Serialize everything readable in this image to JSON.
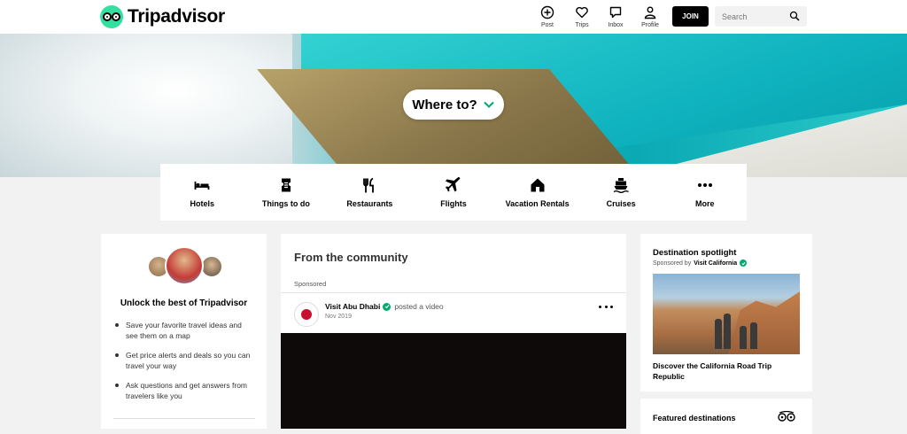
{
  "header": {
    "logo": "Tripadvisor",
    "nav": [
      {
        "label": "Post",
        "icon": "plus-circle-icon"
      },
      {
        "label": "Trips",
        "icon": "heart-icon"
      },
      {
        "label": "Inbox",
        "icon": "chat-icon"
      },
      {
        "label": "Profile",
        "icon": "person-icon"
      }
    ],
    "join_label": "JOIN",
    "search_placeholder": "Search"
  },
  "hero": {
    "where_to": "Where to?"
  },
  "categories": [
    {
      "label": "Hotels",
      "icon": "bed-icon"
    },
    {
      "label": "Things to do",
      "icon": "ticket-icon"
    },
    {
      "label": "Restaurants",
      "icon": "fork-knife-icon"
    },
    {
      "label": "Flights",
      "icon": "plane-icon"
    },
    {
      "label": "Vacation Rentals",
      "icon": "house-icon"
    },
    {
      "label": "Cruises",
      "icon": "ship-icon"
    },
    {
      "label": "More",
      "icon": "more-dots-icon"
    }
  ],
  "left_card": {
    "title": "Unlock the best of Tripadvisor",
    "bullets": [
      "Save your favorite travel ideas and see them on a map",
      "Get price alerts and deals so you can travel your way",
      "Ask questions and get answers from travelers like you"
    ]
  },
  "community": {
    "title": "From the community",
    "sponsored": "Sponsored",
    "post": {
      "author": "Visit Abu Dhabi",
      "action": "posted a video",
      "date": "Nov 2019"
    }
  },
  "spotlight": {
    "title": "Destination spotlight",
    "sponsored_prefix": "Sponsored by",
    "sponsor": "Visit California",
    "caption": "Discover the California Road Trip Republic"
  },
  "featured": {
    "title": "Featured destinations"
  },
  "colors": {
    "brand_green": "#34e0a1",
    "verified_green": "#00aa6c",
    "join_bg": "#000000"
  }
}
